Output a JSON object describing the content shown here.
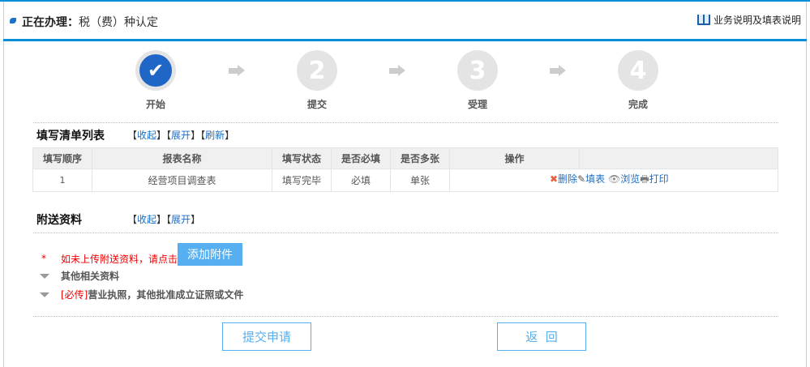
{
  "header": {
    "label": "正在办理：",
    "title": "税（费）种认定",
    "help": "业务说明及填表说明"
  },
  "steps": [
    {
      "label": "开始",
      "num": "✔"
    },
    {
      "label": "提交",
      "num": "2"
    },
    {
      "label": "受理",
      "num": "3"
    },
    {
      "label": "完成",
      "num": "4"
    }
  ],
  "list": {
    "title": "填写清单列表",
    "collapse": "收起",
    "expand": "展开",
    "refresh": "刷新",
    "columns": [
      "填写顺序",
      "报表名称",
      "填写状态",
      "是否必填",
      "是否多张",
      "操作"
    ],
    "rows": [
      {
        "order": "1",
        "name": "经营项目调查表",
        "status": "填写完毕",
        "required": "必填",
        "multi": "单张"
      }
    ],
    "ops": {
      "delete": "删除",
      "fill": "填表",
      "view": "浏览",
      "print": "打印"
    }
  },
  "attach": {
    "title": "附送资料",
    "collapse": "收起",
    "expand": "展开",
    "star": "*",
    "notice": "如未上传附送资料，请点击",
    "add": "添加附件",
    "items": [
      {
        "tag": "",
        "text": "其他相关资料"
      },
      {
        "tag": "[必传]",
        "text": "营业执照，其他批准成立证照或文件"
      }
    ]
  },
  "buttons": {
    "submit": "提交申请",
    "back": "返  回"
  }
}
